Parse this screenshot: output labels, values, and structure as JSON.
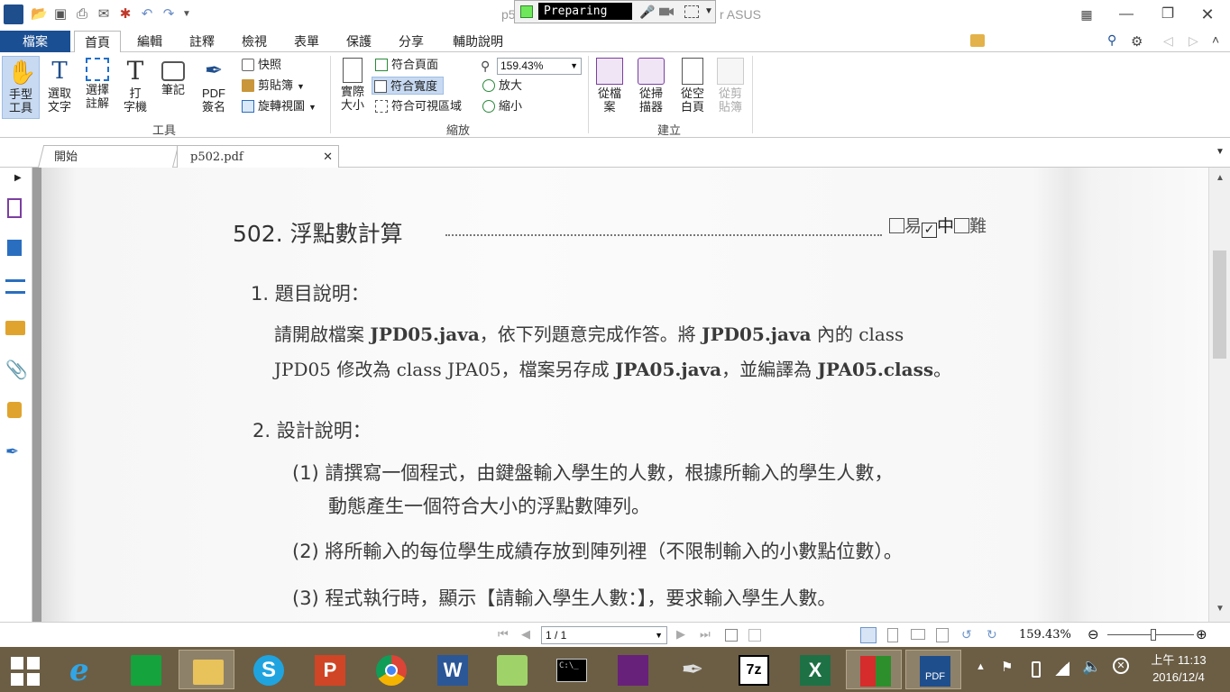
{
  "window": {
    "title_left": "p5",
    "title_right": "r ASUS"
  },
  "recorder": {
    "status": "Preparing ..."
  },
  "menu_tabs": [
    "檔案",
    "首頁",
    "編輯",
    "註釋",
    "檢視",
    "表單",
    "保護",
    "分享",
    "輔助說明"
  ],
  "search": {
    "placeholder": "尋找"
  },
  "ribbon": {
    "tools": {
      "label": "工具",
      "hand": "手型\n工具",
      "select_text": "選取\n文字",
      "select_annot": "選擇\n註解",
      "typewriter": "打\n字機",
      "note": "筆記",
      "pdf_sign": "PDF\n簽名",
      "snapshot": "快照",
      "clipboard": "剪貼簿",
      "rotate": "旋轉視圖"
    },
    "zoom": {
      "label": "縮放",
      "actual_size": "實際\n大小",
      "fit_page": "符合頁面",
      "fit_width": "符合寬度",
      "fit_visible": "符合可視區域",
      "zoom_value": "159.43%",
      "zoom_in": "放大",
      "zoom_out": "縮小"
    },
    "create": {
      "label": "建立",
      "from_file": "從檔\n案",
      "from_scanner": "從掃\n描器",
      "from_blank": "從空\n白頁",
      "from_clipboard": "從剪\n貼簿"
    }
  },
  "doc_tabs": [
    {
      "label": "開始"
    },
    {
      "label": "p502.pdf"
    }
  ],
  "document": {
    "heading": "502. 浮點數計算",
    "difficulty": {
      "easy": "易",
      "medium": "中",
      "hard": "難",
      "selected": "medium"
    },
    "section1_title": "1. 題目說明：",
    "s1_line1_a": "請開啟檔案 ",
    "s1_line1_b": "JPD05.java",
    "s1_line1_c": "，依下列題意完成作答。將 ",
    "s1_line1_d": "JPD05.java",
    "s1_line1_e": " 內的 class",
    "s1_line2_a": "JPD05 修改為 class JPA05，檔案另存成 ",
    "s1_line2_b": "JPA05.java",
    "s1_line2_c": "，並編譯為 ",
    "s1_line2_d": "JPA05.class",
    "s1_line2_e": "。",
    "section2_title": "2. 設計說明：",
    "item1_a": "(1) 請撰寫一個程式，由鍵盤輸入學生的人數，根據所輸入的學生人數，",
    "item1_b": "動態產生一個符合大小的浮點數陣列。",
    "item2": "(2) 將所輸入的每位學生成績存放到陣列裡（不限制輸入的小數點位數）。",
    "item3": "(3) 程式執行時，顯示【請輸入學生人數：】，要求輸入學生人數。"
  },
  "status_bar": {
    "page": "1 / 1",
    "zoom": "159.43%"
  },
  "clock": {
    "time": "上午 11:13",
    "date": "2016/12/4"
  },
  "taskbar_apps": [
    "start-icon",
    "ie-icon",
    "store-icon",
    "file-explorer-icon",
    "skype-icon",
    "powerpoint-icon",
    "chrome-icon",
    "word-icon",
    "notepad-plus-icon",
    "cmd-icon",
    "visual-studio-icon",
    "quill-icon",
    "7zip-icon",
    "excel-icon",
    "winrar-icon",
    "pdf-reader-icon"
  ],
  "colors": {
    "file_tab": "#1b4f93",
    "taskbar": "#6b5e45",
    "recorder_dot": "#6ee85a"
  }
}
